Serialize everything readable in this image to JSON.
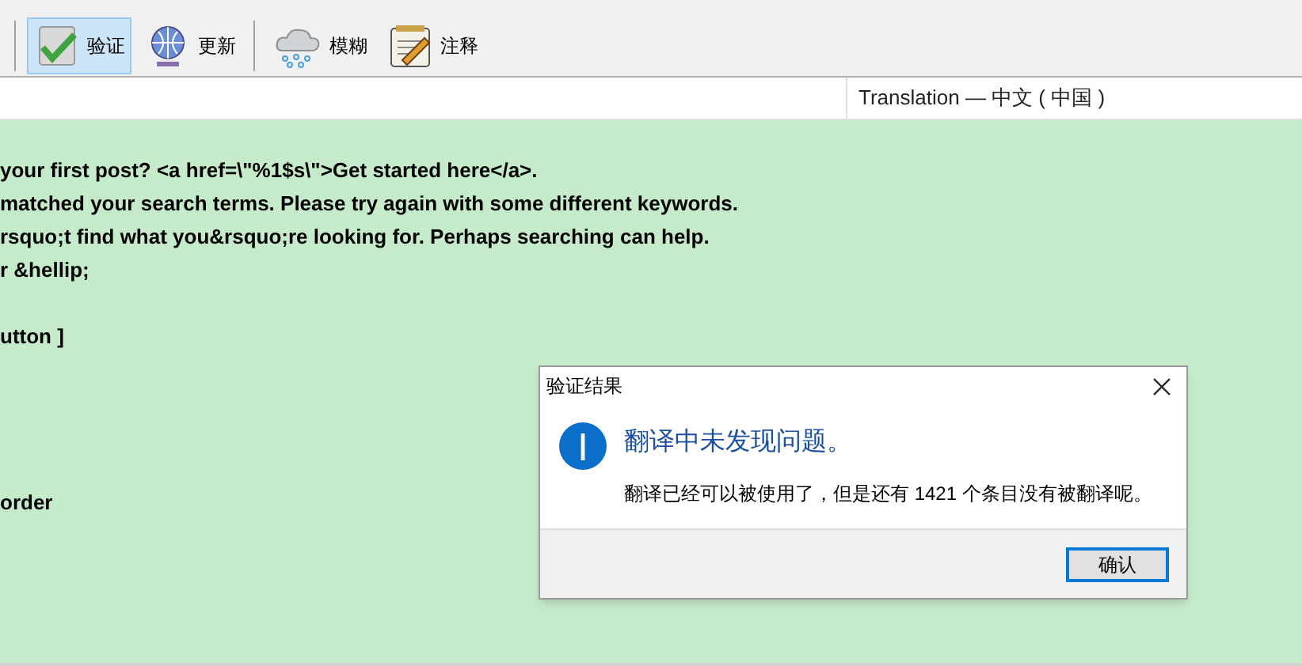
{
  "toolbar": {
    "tools": [
      {
        "kind": "check",
        "label": "验证",
        "selected": true
      },
      {
        "kind": "globe",
        "label": "更新",
        "selected": false
      },
      {
        "kind": "separator"
      },
      {
        "kind": "cloud",
        "label": "模糊",
        "selected": false
      },
      {
        "kind": "notepad",
        "label": "注释",
        "selected": false
      }
    ]
  },
  "table": {
    "columns": [
      "Translation — 中文 ( 中国 )"
    ],
    "rows": [
      "your first post? <a href=\\\"%1$s\\\">Get started here</a>.",
      "matched your search terms. Please try again with some different keywords.",
      "rsquo;t find what you&rsquo;re looking for. Perhaps searching can help.",
      "r &hellip;",
      "",
      "utton ]",
      "",
      "",
      "",
      "",
      "order"
    ]
  },
  "dialog": {
    "title": "验证结果",
    "heading": "翻译中未发现问题。",
    "message": "翻译已经可以被使用了，但是还有 1421 个条目没有被翻译呢。",
    "button": "确认"
  }
}
